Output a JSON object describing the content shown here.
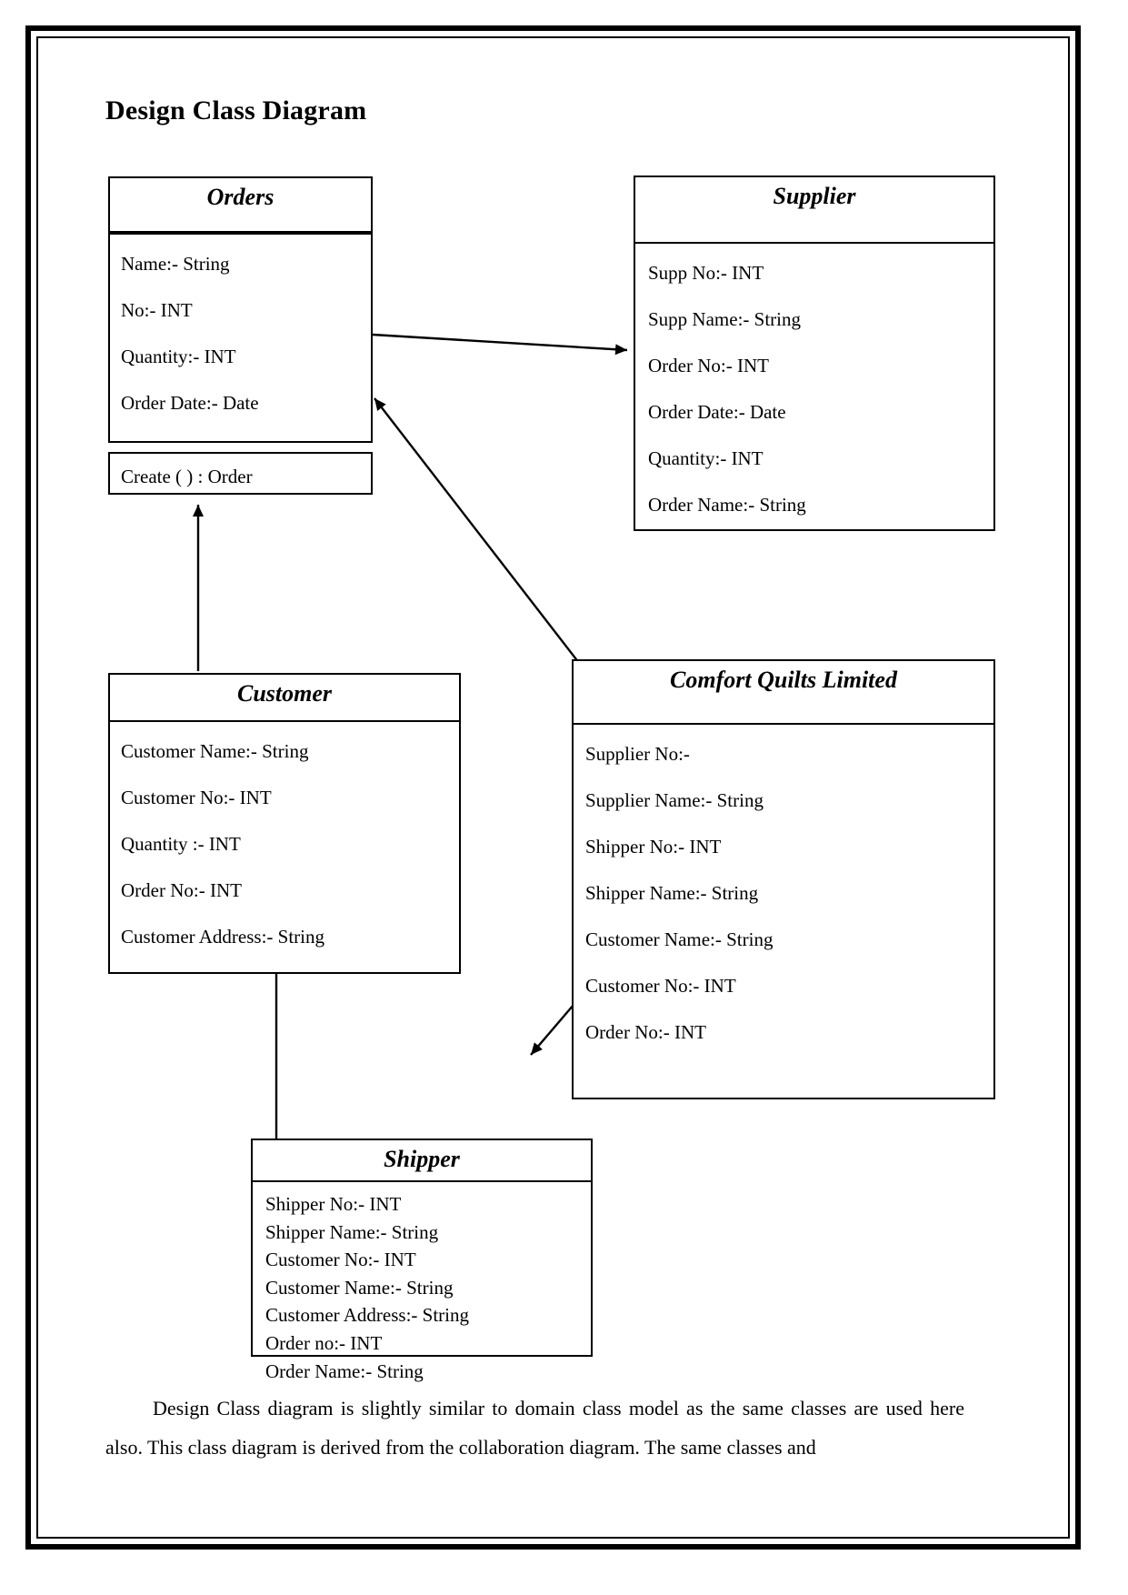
{
  "document": {
    "title": "Design Class Diagram",
    "paragraph_indent": "",
    "paragraph": "Design Class diagram is slightly similar to domain class model as the same classes are used here also. This class diagram is derived from the collaboration diagram. The same classes and"
  },
  "colors": {
    "page_border": "#000000",
    "box_border": "#000000",
    "text": "#000000",
    "background": "#ffffff"
  },
  "classes": [
    {
      "id": "orders",
      "name": "Orders",
      "attributes": [
        "Name:- String",
        "No:- INT",
        "Quantity:- INT",
        "Order Date:- Date"
      ],
      "methods": [
        "Create ( ) : Order"
      ]
    },
    {
      "id": "supplier",
      "name": "Supplier",
      "attributes": [
        "Supp No:- INT",
        "Supp Name:- String",
        "Order No:- INT",
        "Order Date:- Date",
        "Quantity:- INT",
        "Order Name:- String"
      ],
      "methods": []
    },
    {
      "id": "customer",
      "name": "Customer",
      "attributes": [
        "Customer Name:- String",
        "Customer No:- INT",
        "Quantity :- INT",
        "Order No:- INT",
        "Customer Address:- String"
      ],
      "methods": []
    },
    {
      "id": "comfort",
      "name": "Comfort Quilts Limited",
      "attributes": [
        "Supplier No:-",
        "Supplier Name:- String",
        "Shipper No:- INT",
        "Shipper Name:- String",
        "Customer Name:- String",
        "Customer No:- INT",
        "Order No:- INT"
      ],
      "methods": []
    },
    {
      "id": "shipper",
      "name": "Shipper",
      "attributes": [
        "Shipper No:- INT",
        "Shipper Name:- String",
        "Customer No:- INT",
        "Customer Name:- String",
        "Customer Address:- String",
        "Order no:- INT",
        "Order Name:- String"
      ],
      "methods": []
    }
  ],
  "associations": [
    {
      "id": "orders-to-supplier",
      "from": "Orders",
      "to": "Supplier",
      "arrow": "open"
    },
    {
      "id": "comfort-to-orders",
      "from": "Comfort Quilts Limited",
      "to": "Orders",
      "arrow": "open"
    },
    {
      "id": "customer-to-orders",
      "from": "Customer",
      "to": "Orders",
      "arrow": "open"
    },
    {
      "id": "shipper-to-customer",
      "from": "Shipper",
      "to": "Customer",
      "arrow": "open"
    },
    {
      "id": "comfort-to-shipper",
      "from": "Comfort Quilts Limited",
      "to": "Shipper",
      "arrow": "open"
    }
  ]
}
